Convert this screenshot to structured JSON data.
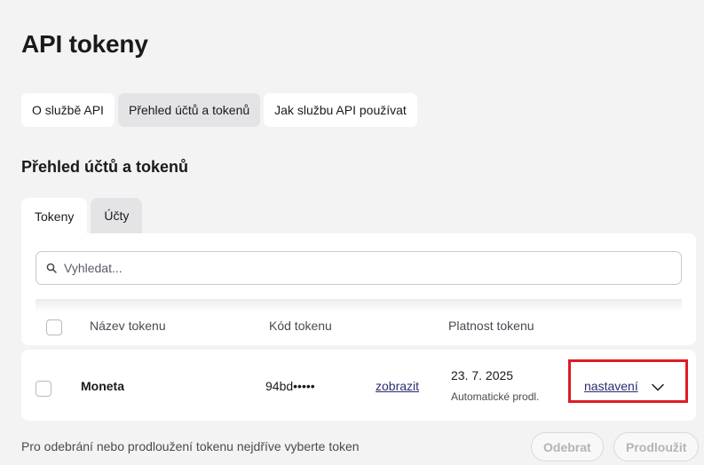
{
  "page": {
    "title": "API tokeny"
  },
  "top_tabs": [
    {
      "label": "O službě API",
      "active": false
    },
    {
      "label": "Přehled účtů a tokenů",
      "active": true
    },
    {
      "label": "Jak službu API používat",
      "active": false
    }
  ],
  "section": {
    "title": "Přehled účtů a tokenů"
  },
  "sub_tabs": [
    {
      "label": "Tokeny",
      "active": true
    },
    {
      "label": "Účty",
      "active": false
    }
  ],
  "search": {
    "placeholder": "Vyhledat...",
    "value": ""
  },
  "table": {
    "headers": {
      "name": "Název tokenu",
      "code": "Kód tokenu",
      "validity": "Platnost tokenu"
    },
    "rows": [
      {
        "name": "Moneta",
        "code": "94bd•••••",
        "show_label": "zobrazit",
        "validity_date": "23. 7. 2025",
        "validity_note": "Automatické prodl.",
        "settings_label": "nastavení"
      }
    ]
  },
  "footer": {
    "hint": "Pro odebrání nebo prodloužení tokenu nejdříve vyberte token",
    "remove_label": "Odebrat",
    "extend_label": "Prodloužit"
  },
  "icons": {
    "search": "search-icon",
    "expand": "chevron-down-icon"
  },
  "colors": {
    "highlight": "#e01b24",
    "link": "#2b2b70",
    "disabled_text": "#b3b3ba"
  }
}
